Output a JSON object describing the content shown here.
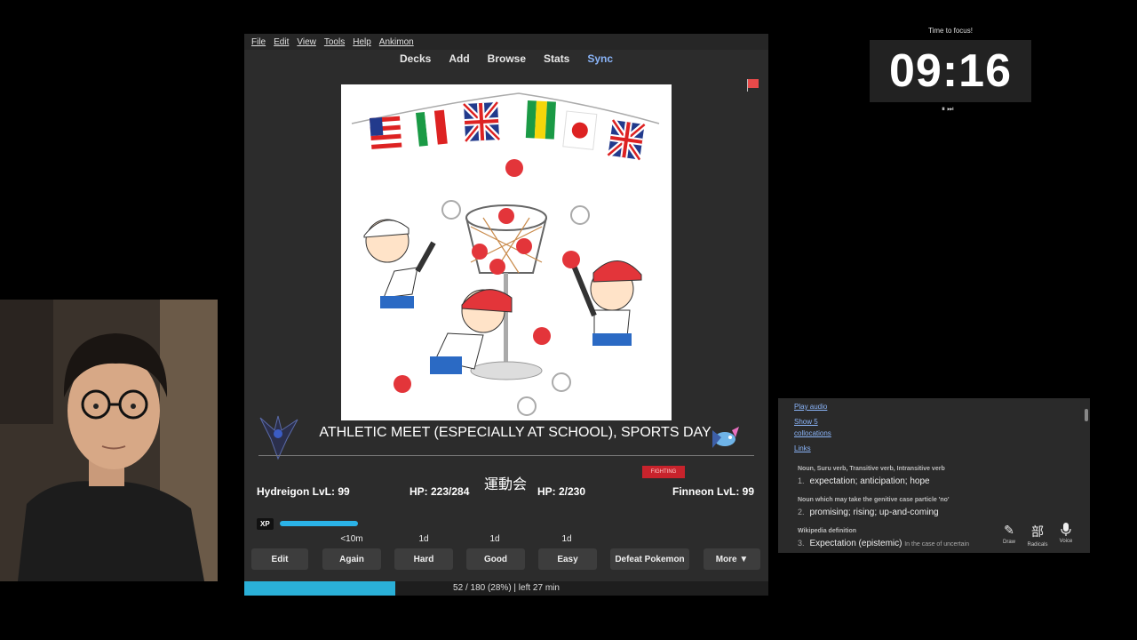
{
  "menu": [
    "File",
    "Edit",
    "View",
    "Tools",
    "Help",
    "Ankimon"
  ],
  "nav": {
    "decks": "Decks",
    "add": "Add",
    "browse": "Browse",
    "stats": "Stats",
    "sync": "Sync"
  },
  "card": {
    "meaning": "ATHLETIC MEET (ESPECIALLY AT SCHOOL), SPORTS DAY",
    "kanji": "運動会"
  },
  "battle": {
    "player_name": "Hydreigon LvL: 99",
    "player_hp": "HP: 223/284",
    "enemy_hp": "HP: 2/230",
    "enemy_name": "Finneon LvL: 99",
    "enemy_type": "FIGHTING",
    "xp_label": "XP",
    "xp_fraction": 0.65
  },
  "answers": {
    "again_interval": "<10m",
    "hard_interval": "1d",
    "good_interval": "1d",
    "easy_interval": "1d",
    "edit": "Edit",
    "again": "Again",
    "hard": "Hard",
    "good": "Good",
    "easy": "Easy",
    "defeat": "Defeat Pokemon",
    "more": "More ▼"
  },
  "progress": {
    "text": "52 / 180 (28%) | left 27 min",
    "fraction": 0.288
  },
  "timer": {
    "label": "Time to focus!",
    "time": "09:16",
    "controls": "⏸ ⏭"
  },
  "dictionary": {
    "play_audio": "Play audio",
    "show_collocations_1": "Show 5",
    "show_collocations_2": "collocations",
    "links": "Links",
    "pos1": "Noun, Suru verb, Transitive verb, Intransitive verb",
    "def1_num": "1.",
    "def1": "expectation; anticipation; hope",
    "pos2": "Noun which may take the genitive case particle 'no'",
    "def2_num": "2.",
    "def2": "promising; rising; up-and-coming",
    "pos3": "Wikipedia definition",
    "def3_num": "3.",
    "def3": "Expectation (epistemic)",
    "def3_extra": "In the case of uncertain",
    "tools": {
      "draw": "Draw",
      "radicals": "Radicals",
      "radicals_glyph": "部",
      "voice": "Voice"
    }
  },
  "colors": {
    "accent_blue": "#2ab0d8",
    "sync_blue": "#8ab4f8",
    "flag_red": "#e84a4a",
    "type_red": "#c8232c"
  }
}
